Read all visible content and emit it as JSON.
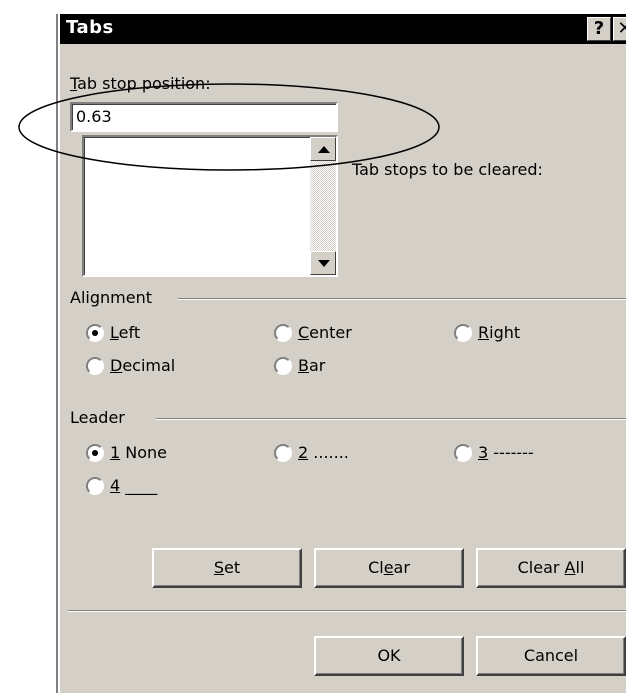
{
  "window": {
    "title": "Tabs",
    "help_glyph": "?",
    "close_glyph": "✕"
  },
  "tab_stop_position": {
    "label_mnemonic": "T",
    "label_rest": "ab stop position:",
    "value": "0.63"
  },
  "tab_stops_list": {
    "items": []
  },
  "clear_label": "Tab stops to be cleared:",
  "alignment": {
    "group_label": "Alignment",
    "options": [
      {
        "id": "left",
        "pre": "",
        "mnemonic": "L",
        "post": "eft",
        "selected": true
      },
      {
        "id": "center",
        "pre": "",
        "mnemonic": "C",
        "post": "enter",
        "selected": false
      },
      {
        "id": "right",
        "pre": "",
        "mnemonic": "R",
        "post": "ight",
        "selected": false
      },
      {
        "id": "decimal",
        "pre": "",
        "mnemonic": "D",
        "post": "ecimal",
        "selected": false
      },
      {
        "id": "bar",
        "pre": "",
        "mnemonic": "B",
        "post": "ar",
        "selected": false
      }
    ]
  },
  "leader": {
    "group_label": "Leader",
    "options": [
      {
        "id": "1",
        "mnemonic": "1",
        "post": " None",
        "selected": true
      },
      {
        "id": "2",
        "mnemonic": "2",
        "post": " .......",
        "selected": false
      },
      {
        "id": "3",
        "mnemonic": "3",
        "post": " -------",
        "selected": false
      },
      {
        "id": "4",
        "mnemonic": "4",
        "post": " ____",
        "selected": false
      }
    ]
  },
  "buttons": {
    "set": {
      "pre": "",
      "mnemonic": "S",
      "post": "et"
    },
    "clear": {
      "pre": "Cl",
      "mnemonic": "e",
      "post": "ar"
    },
    "clear_all": {
      "pre": "Clear ",
      "mnemonic": "A",
      "post": "ll"
    },
    "ok": "OK",
    "cancel": "Cancel"
  },
  "colors": {
    "dialog_bg": "#d4d0c8",
    "titlebar_bg": "#000000",
    "title_text": "#ffffff"
  }
}
